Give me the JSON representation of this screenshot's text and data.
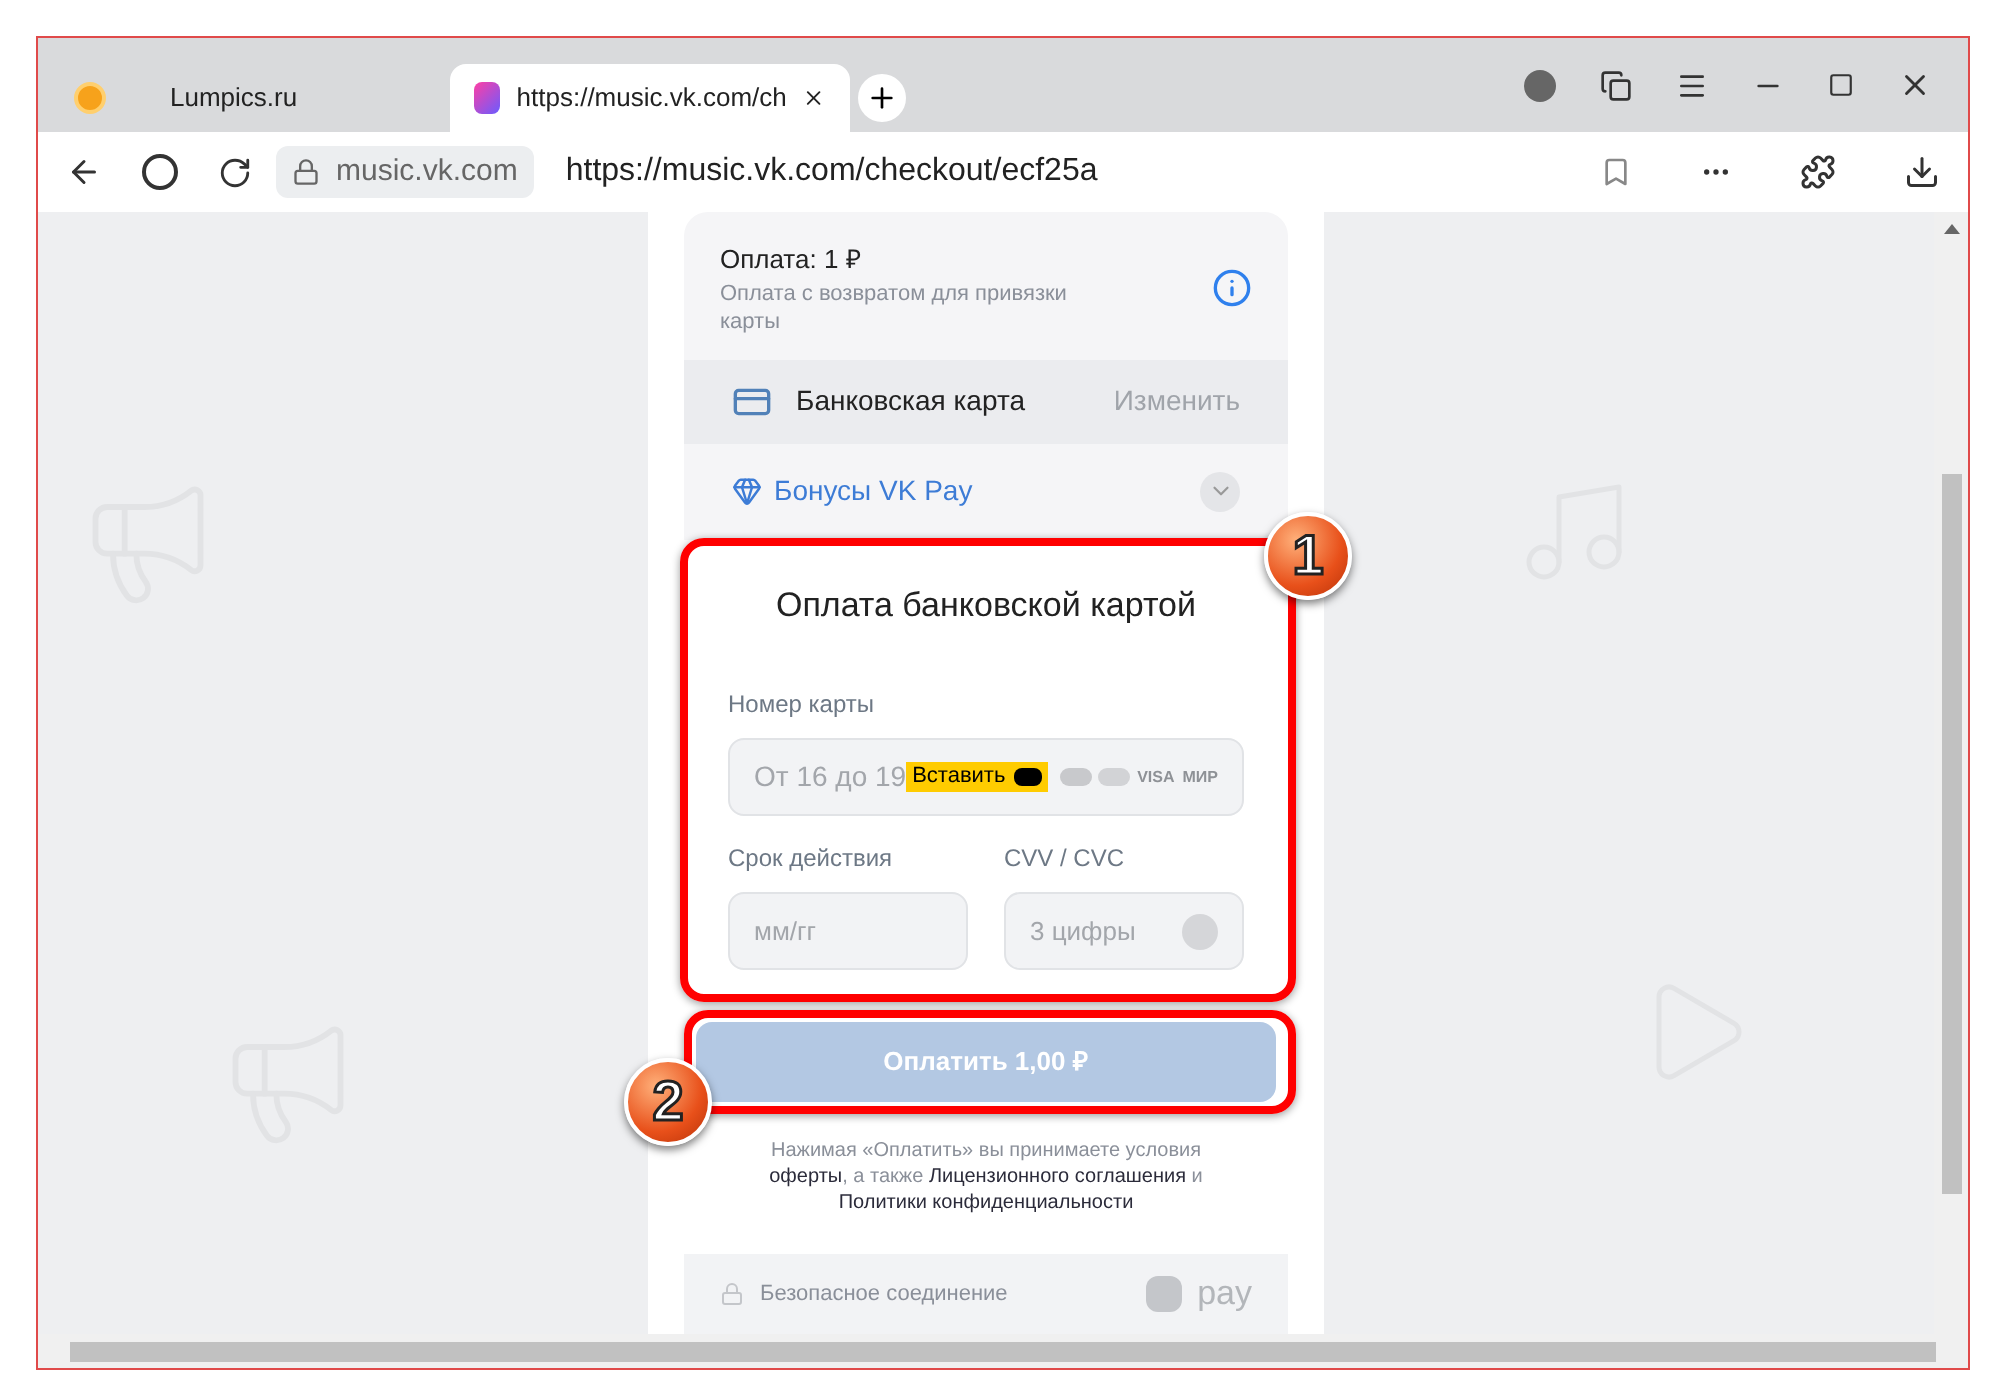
{
  "browser": {
    "tabs": [
      {
        "title": "Lumpics.ru",
        "selected": false
      },
      {
        "title": "https://music.vk.com/ch",
        "selected": true
      }
    ],
    "domain": "music.vk.com",
    "url": "https://music.vk.com/checkout/ecf25a"
  },
  "checkout": {
    "title": "Оплата: 1 ₽",
    "subtitle": "Оплата с возвратом для привязки карты",
    "method": {
      "label": "Банковская карта",
      "action": "Изменить"
    },
    "bonus": {
      "label": "Бонусы VK Pay",
      "expanded": false
    },
    "form": {
      "heading": "Оплата банковской картой",
      "card_number": {
        "label": "Номер карты",
        "placeholder": "От 16 до 19",
        "paste": "Вставить",
        "brands": [
          "VISA",
          "МИР"
        ]
      },
      "expiry": {
        "label": "Срок действия",
        "placeholder": "мм/гг"
      },
      "cvv": {
        "label": "CVV / CVC",
        "placeholder": "3 цифры"
      }
    },
    "pay_button": {
      "label": "Оплатить 1,00 ₽",
      "disabled": true
    },
    "terms": [
      {
        "kind": "plain",
        "text": "Нажимая «Оплатить» вы принимаете условия "
      },
      {
        "kind": "link",
        "text": "оферты"
      },
      {
        "kind": "plain",
        "text": ", а также "
      },
      {
        "kind": "link",
        "text": "Лицензионного соглашения"
      },
      {
        "kind": "plain",
        "text": " и "
      },
      {
        "kind": "link",
        "text": "Политики конфиденциальности"
      }
    ],
    "footer": {
      "secure": "Безопасное соединение",
      "brand": "pay"
    }
  },
  "callouts": [
    {
      "number": "1"
    },
    {
      "number": "2"
    }
  ]
}
